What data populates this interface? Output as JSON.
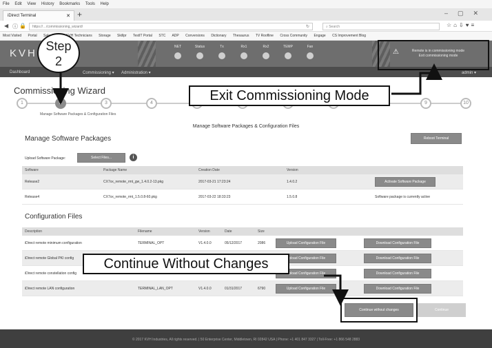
{
  "browser": {
    "menu": [
      "File",
      "Edit",
      "View",
      "History",
      "Bookmarks",
      "Tools",
      "Help"
    ],
    "tab_title": "iDirect Terminal",
    "url": "https://…/commissioning_wizard/",
    "search_placeholder": "Search",
    "bookmarks": [
      "Most Visited",
      "Portal",
      "Salesforce",
      "KVH Technicians",
      "Storage",
      "Skillpr",
      "TestIT Portal",
      "STC",
      "ADP",
      "Conversions",
      "Dictionary",
      "Thesaurus",
      "TV Roofline",
      "Cross Community",
      "Engage",
      "CS Improvement Blog"
    ]
  },
  "app": {
    "logo": "KVH",
    "indicators": [
      "NET",
      "Status",
      "Tx",
      "Rx1",
      "Rx2",
      "TEMP",
      "Fan"
    ],
    "comm_warning_line1": "Remote is in commissioning mode",
    "comm_warning_line2": "Exit commissioning mode",
    "nav": {
      "dashboard": "Dashboard",
      "commissioning": "Commissioning ▾",
      "administration": "Administration ▾",
      "admin": "admin ▾"
    }
  },
  "wizard": {
    "title": "Commissioning Wizard",
    "steps": [
      "1",
      "2",
      "3",
      "4",
      "5",
      "6",
      "7",
      "8",
      "9",
      "10"
    ],
    "step_subtitle": "Manage Software Packages & Configuration Files",
    "page_heading": "Manage Software Packages & Configuration Files"
  },
  "software": {
    "title": "Manage Software Packages",
    "reboot_button": "Reboot Terminal",
    "upload_label": "Upload Software Package:",
    "select_files_button": "Select Files...",
    "columns": [
      "Software",
      "Package Name",
      "Creation Date",
      "Version"
    ],
    "rows": [
      {
        "software": "Release2",
        "package": "CX7xx_remote_rmt_gw_1.4.0.2-13.pkg",
        "date": "2017-03-21 17:23:24",
        "version": "1.4.0.2",
        "action": "Activate Software Package"
      },
      {
        "software": "Release4",
        "package": "CX7xx_remote_rmt_1.5.0.8-60.pkg",
        "date": "2017-03-22 18:33:23",
        "version": "1.5.0.8",
        "action": "Software package is currently active"
      }
    ]
  },
  "config": {
    "title": "Configuration Files",
    "columns": [
      "Description",
      "Filename",
      "Version",
      "Date",
      "Size"
    ],
    "upload_button": "Upload Configuration File",
    "download_button": "Download Configuration File",
    "rows": [
      {
        "description": "iDirect remote minimum configuration",
        "filename": "TERMINAL_OPT",
        "version": "V1.4.0.0",
        "date": "05/12/2017",
        "size": "2086"
      },
      {
        "description": "iDirect remote Global PKI config",
        "filename": "",
        "version": "",
        "date": "",
        "size": ""
      },
      {
        "description": "iDirect remote constellation config",
        "filename": "",
        "version": "",
        "date": "",
        "size": ""
      },
      {
        "description": "iDirect remote LAN configuration",
        "filename": "TERMINAL_LAN_OPT",
        "version": "V1.4.0.0",
        "date": "01/31/2017",
        "size": "6790"
      }
    ]
  },
  "footer": {
    "text": "© 2017 KVH Industries, All rights reserved. | 50 Enterprise Center, Middletown, RI 02842 USA | Phone: +1 401 847 3327 | Toll-Free: +1 866 548 2883"
  },
  "actions": {
    "continue_without_changes": "Continue without changes",
    "continue": "Continue"
  },
  "annotations": {
    "step_callout_line1": "Step",
    "step_callout_line2": "2",
    "exit_label": "Exit Commissioning Mode",
    "continue_label": "Continue Without Changes"
  }
}
